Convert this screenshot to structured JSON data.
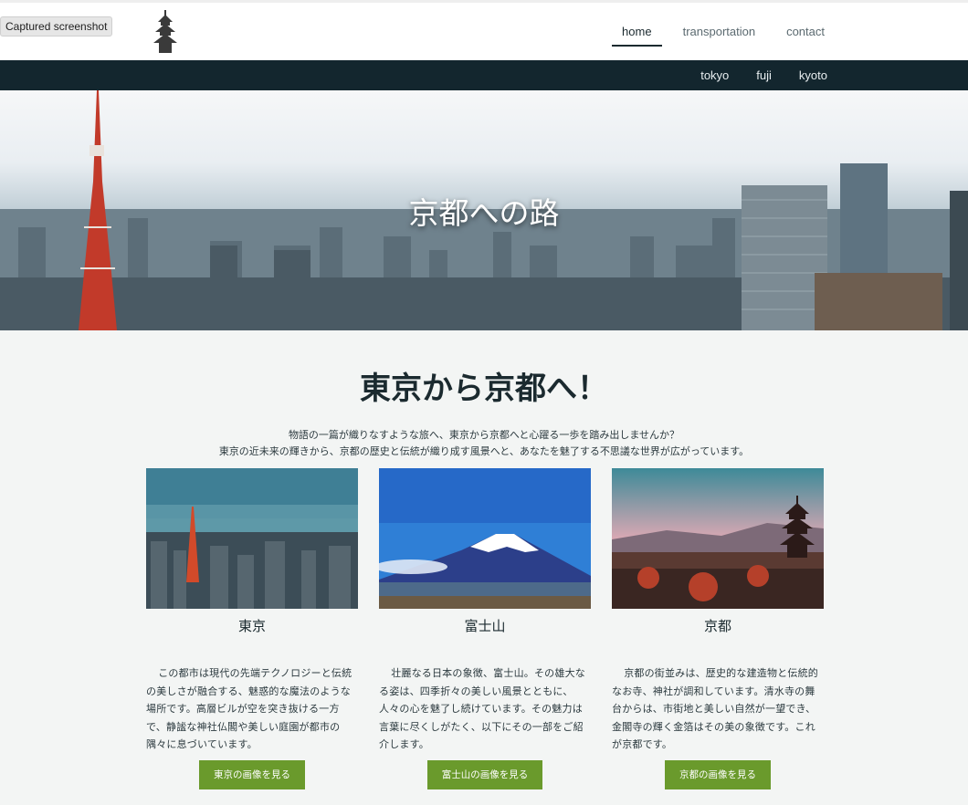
{
  "tooltip": "Captured screenshot",
  "nav": {
    "home": "home",
    "transportation": "transportation",
    "contact": "contact"
  },
  "subnav": {
    "tokyo": "tokyo",
    "fuji": "fuji",
    "kyoto": "kyoto"
  },
  "hero": {
    "title": "京都への路"
  },
  "main": {
    "title": "東京から京都へ！",
    "intro_line1": "物語の一篇が織りなすような旅へ、東京から京都へと心躍る一歩を踏み出しませんか？",
    "intro_line2": "東京の近未来の輝きから、京都の歴史と伝統が織り成す風景へと、あなたを魅了する不思議な世界が広がっています。"
  },
  "cards": [
    {
      "title": "東京",
      "text": "この都市は現代の先端テクノロジーと伝統の美しさが融合する、魅惑的な魔法のような場所です。高層ビルが空を突き抜ける一方で、静謐な神社仏閣や美しい庭園が都市の隅々に息づいています。",
      "button": "東京の画像を見る"
    },
    {
      "title": "富士山",
      "text": "壮麗なる日本の象徴、富士山。その雄大なる姿は、四季折々の美しい風景とともに、人々の心を魅了し続けています。その魅力は言葉に尽くしがたく、以下にその一部をご紹介します。",
      "button": "富士山の画像を見る"
    },
    {
      "title": "京都",
      "text": "京都の街並みは、歴史的な建造物と伝統的なお寺、神社が調和しています。清水寺の舞台からは、市街地と美しい自然が一望でき、金閣寺の輝く金箔はその美の象徴です。これが京都です。",
      "button": "京都の画像を見る"
    }
  ],
  "colors": {
    "subnav_bg": "#13262e",
    "button_bg": "#6a9a2c",
    "text_dark": "#1b2a2f"
  },
  "icons": {
    "logo": "pagoda-icon"
  }
}
